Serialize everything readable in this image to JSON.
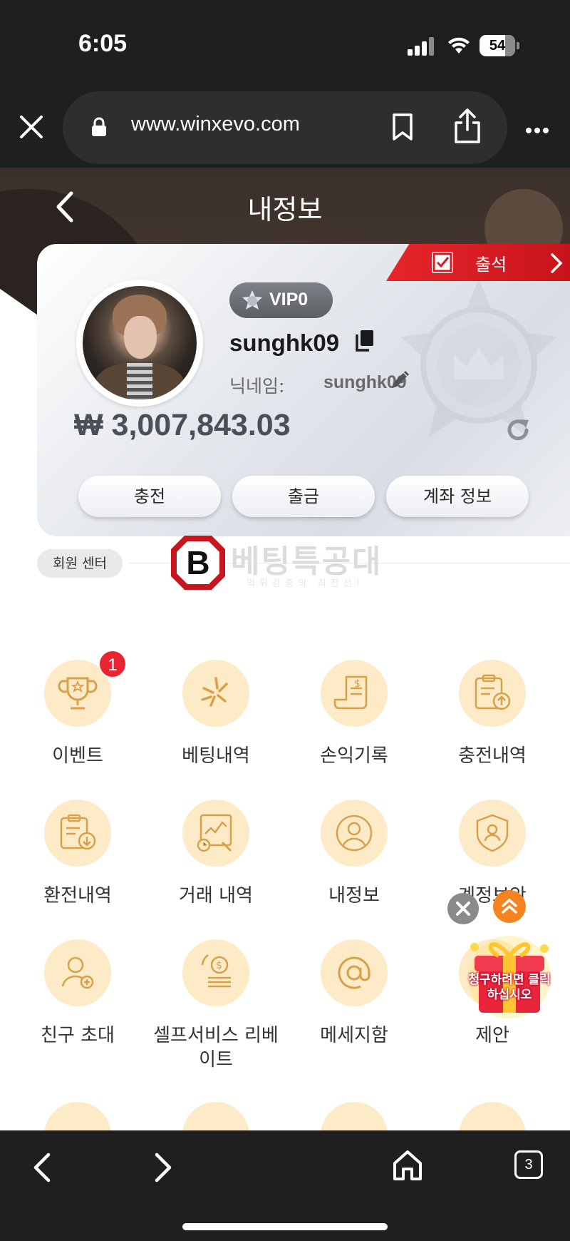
{
  "status_bar": {
    "time": "6:05",
    "battery": "54"
  },
  "browser": {
    "url": "www.winxevo.com",
    "tab_count": "3"
  },
  "page": {
    "title": "내정보"
  },
  "profile": {
    "attendance_label": "출석",
    "vip_label": "VIP0",
    "username": "sunghk09",
    "nickname_prefix": "닉네임: ",
    "nickname": "sunghk09",
    "balance": "₩ 3,007,843.03",
    "buttons": {
      "deposit": "충전",
      "withdraw": "출금",
      "account_info": "계좌 정보"
    }
  },
  "section": {
    "tag": "회원 센터"
  },
  "watermark": {
    "logo": "B",
    "text": "베팅특공대",
    "sub": "먹튀검증의 최전선!"
  },
  "menu": [
    {
      "label": "이벤트",
      "icon": "trophy-icon",
      "badge": "1"
    },
    {
      "label": "베팅내역",
      "icon": "burst-icon"
    },
    {
      "label": "손익기록",
      "icon": "receipt-icon"
    },
    {
      "label": "충전내역",
      "icon": "clipboard-upload-icon"
    },
    {
      "label": "환전내역",
      "icon": "clipboard-download-icon"
    },
    {
      "label": "거래 내역",
      "icon": "chart-history-icon"
    },
    {
      "label": "내정보",
      "icon": "user-circle-icon"
    },
    {
      "label": "계정보안",
      "icon": "shield-user-icon"
    },
    {
      "label": "친구 초대",
      "icon": "add-user-icon"
    },
    {
      "label": "셀프서비스 리베이트",
      "icon": "coin-rebate-icon"
    },
    {
      "label": "메세지함",
      "icon": "at-sign-icon"
    },
    {
      "label": "제안",
      "icon": "suggestion-icon"
    }
  ],
  "promo": {
    "text": "청구하려면 클릭하십시오"
  },
  "colors": {
    "accent": "#e6262c",
    "menu_circle": "#fdebc8",
    "icon_gold": "#d9a04a",
    "float_up": "#f5831f"
  }
}
